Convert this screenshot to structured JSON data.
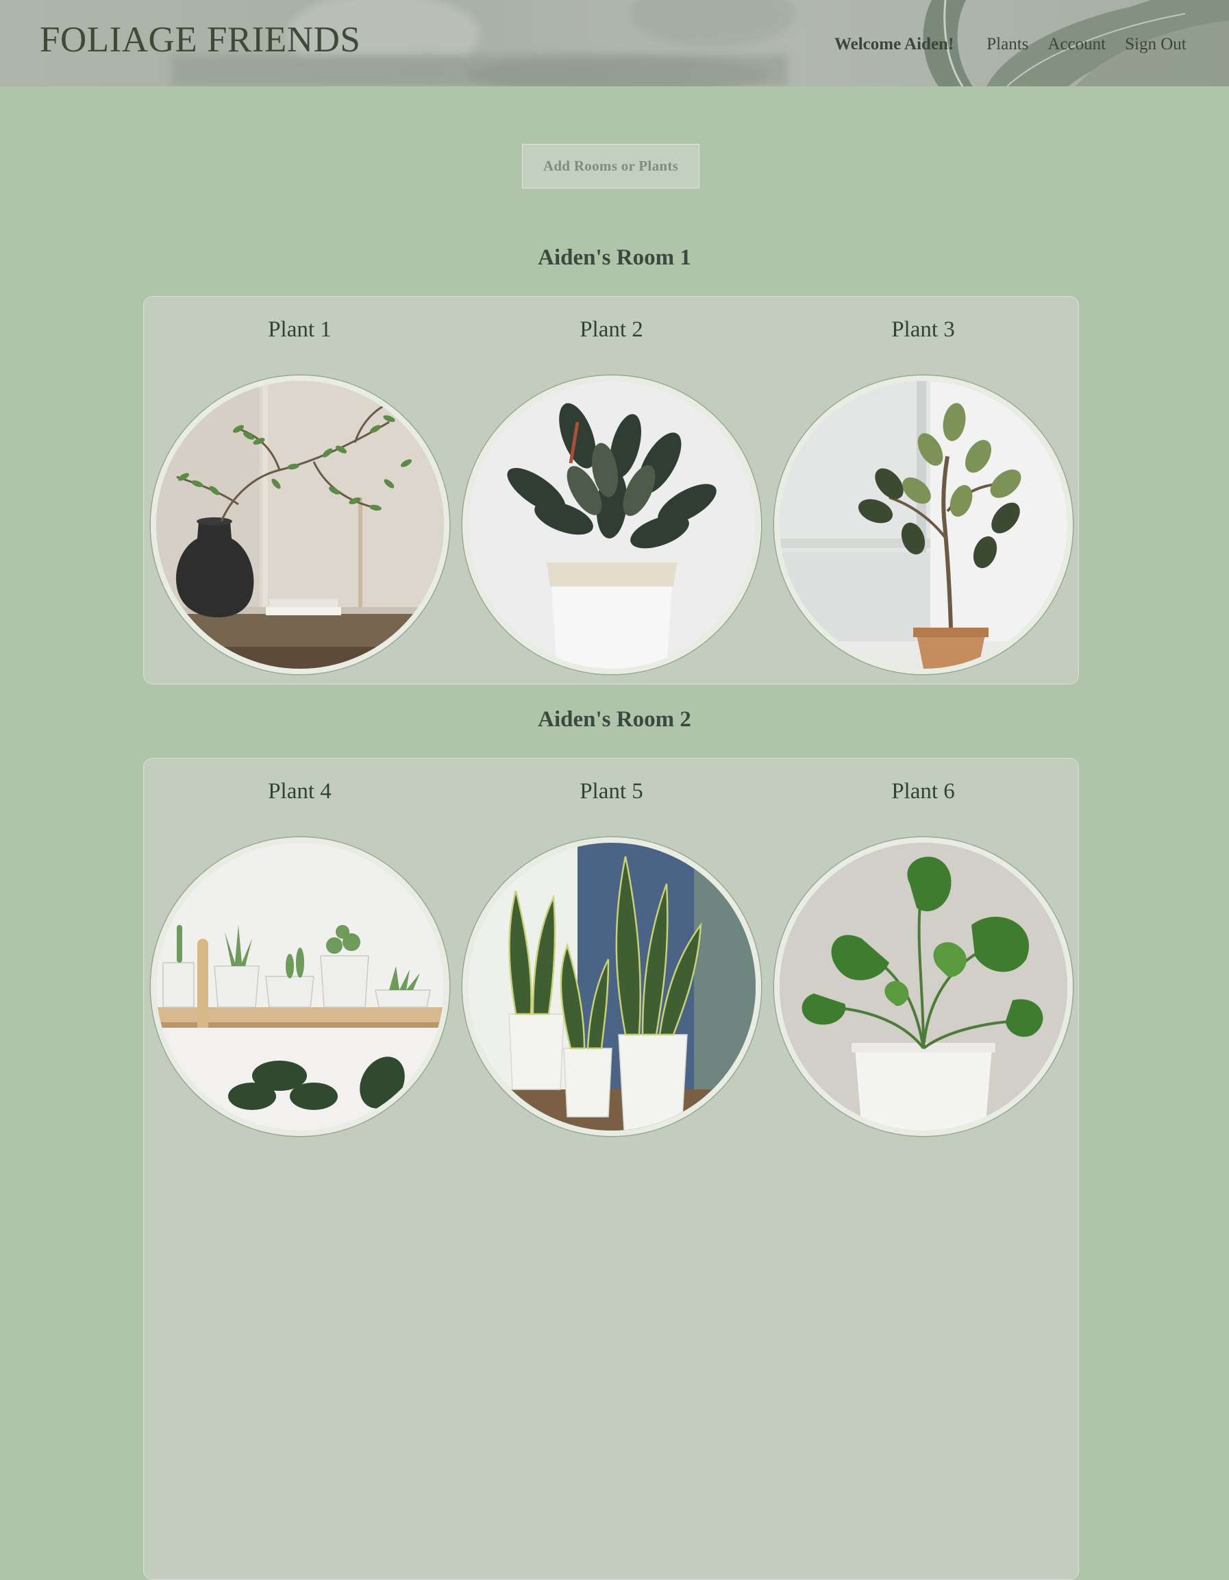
{
  "header": {
    "brand": "FOLIAGE FRIENDS",
    "welcome": "Welcome Aiden!",
    "nav": [
      "Plants",
      "Account",
      "Sign Out"
    ]
  },
  "actions": {
    "add_label": "Add Rooms or Plants"
  },
  "rooms": [
    {
      "title": "Aiden's Room 1",
      "plants": [
        {
          "name": "Plant 1",
          "image": "olive-branches-black-vase"
        },
        {
          "name": "Plant 2",
          "image": "rubber-plant-paper-bag"
        },
        {
          "name": "Plant 3",
          "image": "ficus-tree-by-window"
        }
      ]
    },
    {
      "title": "Aiden's Room 2",
      "plants": [
        {
          "name": "Plant 4",
          "image": "succulents-on-shelf"
        },
        {
          "name": "Plant 5",
          "image": "snake-plants-white-pots"
        },
        {
          "name": "Plant 6",
          "image": "monstera-white-pot"
        }
      ]
    }
  ],
  "colors": {
    "page_bg": "#b0c4a9",
    "panel_bg": "#c2cdbe",
    "brand_text": "#3d4a38",
    "plant_name": "#2f4434"
  }
}
